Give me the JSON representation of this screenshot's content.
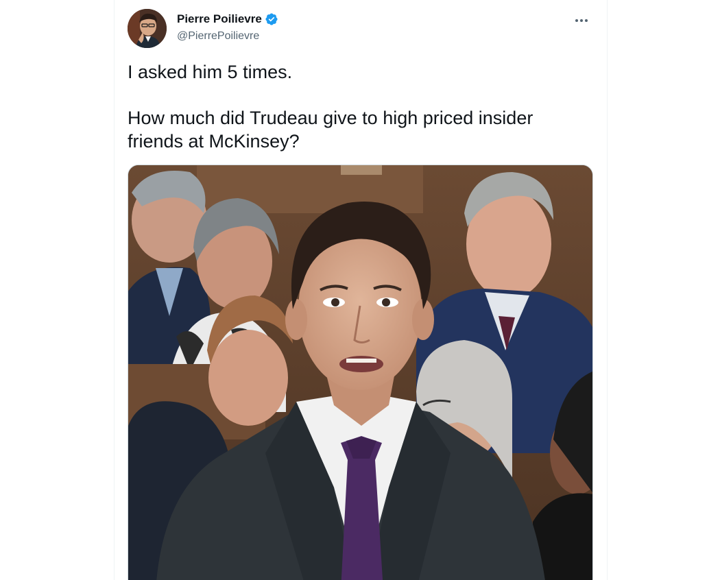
{
  "author": {
    "name": "Pierre Poilievre",
    "handle": "@PierrePoilievre",
    "verified": true,
    "verified_color": "#1d9bf0"
  },
  "tweet": {
    "paragraphs": [
      "I asked him 5 times.",
      "How much did Trudeau give to high priced insider friends at McKinsey?"
    ]
  },
  "icons": {
    "more": "more-horizontal-icon",
    "verified": "verified-badge-icon"
  },
  "colors": {
    "text_primary": "#0f1419",
    "text_secondary": "#536471",
    "border": "#eff3f4",
    "accent": "#1d9bf0"
  }
}
